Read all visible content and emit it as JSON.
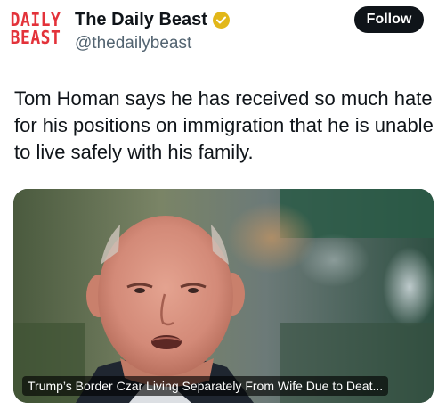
{
  "author": {
    "avatar_lines": [
      "DAILY",
      "BEAST"
    ],
    "display_name": "The Daily Beast",
    "handle": "@thedailybeast",
    "verified_icon": "gold-checkmark-badge-icon",
    "verified_color": "#e2b719",
    "avatar_color": "#e3323a"
  },
  "follow_button": {
    "label": "Follow"
  },
  "post": {
    "text": "Tom Homan says he has received so much hate for his positions on immigration that he is unable to live safely with his family."
  },
  "link_card": {
    "image_description": "photo-of-man",
    "headline": "Trump’s Border Czar Living Separately From Wife Due to Deat..."
  }
}
